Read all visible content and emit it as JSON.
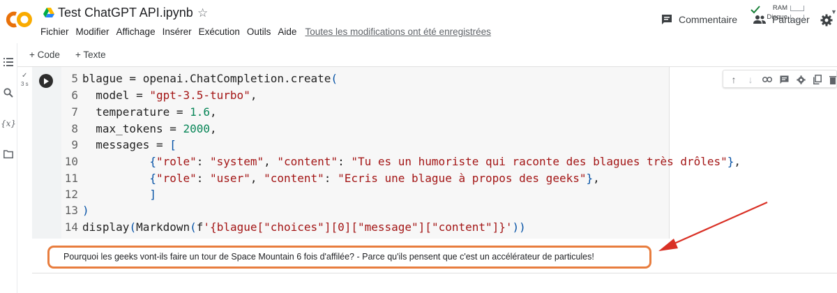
{
  "header": {
    "title": "Test ChatGPT API.ipynb",
    "menu": [
      "Fichier",
      "Modifier",
      "Affichage",
      "Insérer",
      "Exécution",
      "Outils",
      "Aide"
    ],
    "save_status": "Toutes les modifications ont été enregistrées",
    "comment_label": "Commentaire",
    "share_label": "Partager",
    "colors": {
      "logo_orange": "#f9ab00",
      "logo_amber": "#e8710a"
    }
  },
  "toolbar": {
    "add_code": "+ Code",
    "add_text": "+ Texte",
    "ram_label": "RAM",
    "disk_label": "Disque"
  },
  "cell": {
    "exec_time": "3 s",
    "lines": [
      {
        "num": "5",
        "code": "blague = openai.ChatCompletion.create("
      },
      {
        "num": "6",
        "code": "  model = \"gpt-3.5-turbo\","
      },
      {
        "num": "7",
        "code": "  temperature = 1.6,"
      },
      {
        "num": "8",
        "code": "  max_tokens = 2000,"
      },
      {
        "num": "9",
        "code": "  messages = ["
      },
      {
        "num": "10",
        "code": "          {\"role\": \"system\", \"content\": \"Tu es un humoriste qui raconte des blagues très drôles\"},"
      },
      {
        "num": "11",
        "code": "          {\"role\": \"user\", \"content\": \"Ecris une blague à propos des geeks\"},"
      },
      {
        "num": "12",
        "code": "          ]"
      },
      {
        "num": "13",
        "code": ")"
      },
      {
        "num": "14",
        "code": "display(Markdown(f'{blague[\"choices\"][0][\"message\"][\"content\"]}'))"
      }
    ]
  },
  "output": {
    "text": "Pourquoi les geeks vont-ils faire un tour de Space Mountain 6 fois d'affilée? - Parce qu'ils pensent que c'est un accélérateur de particules!",
    "highlight_color": "#e87d3e",
    "arrow_color": "#d93025"
  },
  "icons": {
    "rail": [
      "menu-icon",
      "search-icon",
      "variables-icon",
      "folder-icon"
    ],
    "cell_tools": [
      "arrow-up-icon",
      "arrow-down-icon",
      "link-icon",
      "comment-icon",
      "settings-icon",
      "mirror-icon",
      "delete-icon"
    ]
  }
}
